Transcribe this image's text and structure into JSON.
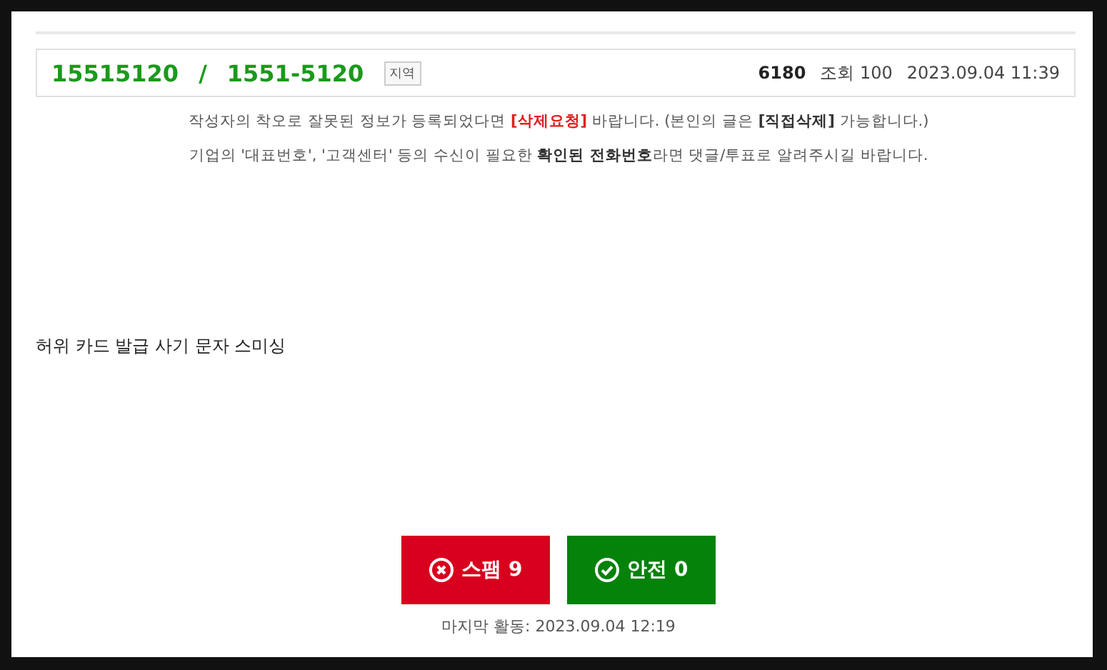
{
  "header": {
    "number": "15515120",
    "separator": "/",
    "formatted": "1551-5120",
    "tag": "지역",
    "score": "6180",
    "views": "조회 100",
    "date": "2023.09.04 11:39"
  },
  "notices": [
    "작성자의 착오로 잘못된 정보가 등록되었다면 **[삭제요청]** 바랍니다. (본인의 글은 **[직접삭제]** 가능합니다.)",
    "기업의 '대표번호', '고객센터' 등의 수신이 필요한 **확인된 전화번호**라면 댓글/투표로 알려주시길 바랍니다."
  ],
  "content": "허위 카드 발급 사기 문자 스미싱",
  "votes": [
    {
      "kind": "spam",
      "label": "스팸 9"
    },
    {
      "kind": "safe",
      "label": "안전 0"
    }
  ],
  "last_activity": "마지막 활동: 2023.09.04 12:19"
}
